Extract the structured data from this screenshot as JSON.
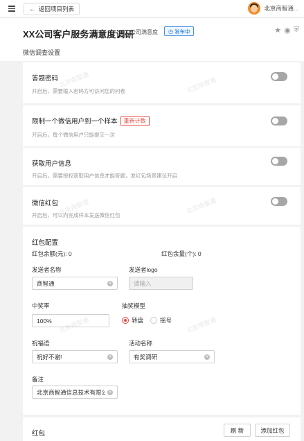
{
  "topbar": {
    "back_label": "返回项目列表",
    "user_name": "北京商智通..."
  },
  "header": {
    "title": "XX公司客户服务满意度调研",
    "subtitle": "公司满意度",
    "status": "发布中",
    "section": "微信调查设置"
  },
  "settings": [
    {
      "title": "答题密码",
      "desc": "开启后，需要输入密码方可访问您的问卷",
      "enabled": false
    },
    {
      "title": "限制一个微信用户到一个样本",
      "badge": "重新计数",
      "desc": "开启后，每个微信用户只能提交一次",
      "enabled": false
    },
    {
      "title": "获取用户信息",
      "desc": "开启后，需要授权获取用户信息才能答题，发红包场景建议开启",
      "enabled": false
    },
    {
      "title": "微信红包",
      "desc": "开启后，可以向完成样本发送微信红包",
      "enabled": false
    }
  ],
  "redpacket": {
    "heading": "红包配置",
    "balance_amount": "红包余额(元): 0",
    "balance_count": "红包余量(个): 0",
    "sender_name_label": "发送者名称",
    "sender_name_value": "商智通",
    "sender_logo_label": "发送者logo",
    "sender_logo_placeholder": "请输入",
    "win_rate_label": "中奖率",
    "win_rate_value": "100%",
    "model_label": "抽奖模型",
    "model_options": [
      "转盘",
      "摇号"
    ],
    "model_selected": "转盘",
    "blessing_label": "祝福语",
    "blessing_value": "祝好不谢!",
    "activity_label": "活动名称",
    "activity_value": "有奖调研",
    "remark_label": "备注",
    "remark_value": "北京商智通信息技术有限公司"
  },
  "redpacket_list": {
    "title": "红包",
    "refresh_label": "刷 新",
    "add_label": "添加红包"
  },
  "watermark": "北京商智通",
  "colors": {
    "accent_blue": "#1a73e8",
    "danger_red": "#e54d42",
    "toggle_off": "#a6a6a6"
  }
}
